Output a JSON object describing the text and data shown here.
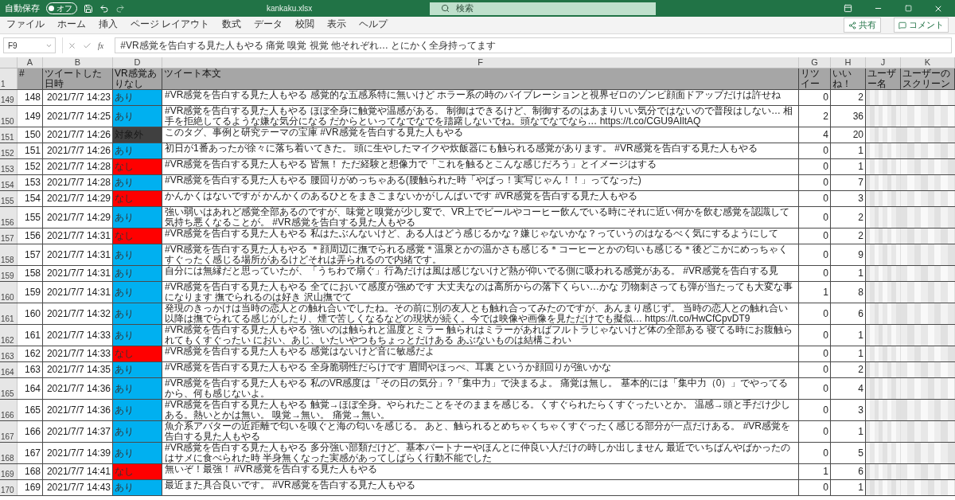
{
  "title_bar": {
    "autosave_label": "自動保存",
    "autosave_state": "オフ",
    "autosave_on": false,
    "filename": "kankaku.xlsx",
    "search_placeholder": "検索"
  },
  "ribbon_tabs": [
    {
      "label": "ファイル",
      "selected": false
    },
    {
      "label": "ホーム",
      "selected": false
    },
    {
      "label": "挿入",
      "selected": false
    },
    {
      "label": "ページ レイアウト",
      "selected": false
    },
    {
      "label": "数式",
      "selected": false
    },
    {
      "label": "データ",
      "selected": false
    },
    {
      "label": "校閲",
      "selected": false
    },
    {
      "label": "表示",
      "selected": false
    },
    {
      "label": "ヘルプ",
      "selected": false
    }
  ],
  "ribbon_actions": [
    "共有",
    "コメント"
  ],
  "formula_bar": {
    "name_box": "F9",
    "fx": "fx",
    "formula": "#VR感覚を告白する見た人もやる 痛覚 嗅覚 視覚 他それぞれ… とにかく全身持ってます"
  },
  "column_letters": [
    "A",
    "B",
    "D",
    "F",
    "G",
    "H",
    "J",
    "K"
  ],
  "header_row": {
    "row_number": "1",
    "cells": [
      "#",
      "ツイートした日時",
      "VR感覚ありなし",
      "ツイート本文",
      "リツイー",
      "いいね！",
      "ユーザー名",
      "ユーザーのスクリーン"
    ]
  },
  "rows": [
    {
      "row_number": "149",
      "index": "148",
      "date": "2021/7/7 14:23",
      "flag": "あり",
      "color": "#00b0f0",
      "text": "#VR感覚を告白する見た人もやる 感覚的な五感系特に無いけど ホラー系の時のバイブレーションと視界ゼロのゾンビ顔面ドアップだけは許せね",
      "retweets": "0",
      "likes": "2"
    },
    {
      "row_number": "150",
      "index": "149",
      "date": "2021/7/7 14:25",
      "flag": "あり",
      "color": "#00b0f0",
      "text": "#VR感覚を告白する見た人もやる ほぼ全身に触覚や温感がある。 制御はできるけど、制御するのはあまりいい気分ではないので普段はしない… 相手を拒絶してるような嫌な気分になる だからといってなでなでを躊躇しないでね。頭なでなでなら… https://t.co/CGU9AIltAQ",
      "retweets": "2",
      "likes": "36"
    },
    {
      "row_number": "151",
      "index": "150",
      "date": "2021/7/7 14:26",
      "flag": "対象外",
      "color": "#404040",
      "text": "このタグ、事例と研究テーマの宝庫 #VR感覚を告白する見た人もやる",
      "retweets": "4",
      "likes": "20"
    },
    {
      "row_number": "152",
      "index": "151",
      "date": "2021/7/7 14:26",
      "flag": "あり",
      "color": "#00b0f0",
      "text": "初日が1番あったが徐々に落ち着いてきた。 頭に生やしたマイクや炊飯器にも触られる感覚があります。 #VR感覚を告白する見た人もやる",
      "retweets": "0",
      "likes": "1"
    },
    {
      "row_number": "153",
      "index": "152",
      "date": "2021/7/7 14:28",
      "flag": "なし",
      "color": "#ff0000",
      "text": "#VR感覚を告白する見た人もやる 皆無！ ただ経験と想像力で「これを触るとこんな感じだろう」とイメージはする",
      "retweets": "0",
      "likes": "1"
    },
    {
      "row_number": "154",
      "index": "153",
      "date": "2021/7/7 14:28",
      "flag": "あり",
      "color": "#00b0f0",
      "text": "#VR感覚を告白する見た人もやる 腰回りがめっちゃある(腰触られた時「やばっ！実写じゃん！！」ってなった)",
      "retweets": "0",
      "likes": "7"
    },
    {
      "row_number": "155",
      "index": "154",
      "date": "2021/7/7 14:29",
      "flag": "なし",
      "color": "#ff0000",
      "text": "かんかくはないですが かんかくのあるひとをまきこまないかがしんぱいです #VR感覚を告白する見た人もやる",
      "retweets": "0",
      "likes": "3"
    },
    {
      "row_number": "156",
      "index": "155",
      "date": "2021/7/7 14:29",
      "flag": "あり",
      "color": "#00b0f0",
      "text": "強い弱いはあれど感覚全部あるのですが、味覚と嗅覚が少し変で、VR上でビールやコーヒー飲んでいる時にそれに近い何かを飲む感覚を認識して気持ち悪くなることが。 #VR感覚を告白する見た人もやる",
      "retweets": "0",
      "likes": "2"
    },
    {
      "row_number": "157",
      "index": "156",
      "date": "2021/7/7 14:31",
      "flag": "なし",
      "color": "#ff0000",
      "text": "#VR感覚を告白する見た人もやる 私はたぶんないけど、ある人はどう感じるかな？嫌じゃないかな？っていうのはなるべく気にするようにして",
      "retweets": "0",
      "likes": "2"
    },
    {
      "row_number": "158",
      "index": "157",
      "date": "2021/7/7 14:31",
      "flag": "あり",
      "color": "#00b0f0",
      "text": "#VR感覚を告白する見た人もやる ＊顔周辺に撫でられる感覚＊温泉とかの温かさも感じる＊コーヒーとかの匂いも感じる＊後どこかにめっちゃくすぐったく感じる場所があるけどそれは弄られるので内緒です。",
      "retweets": "0",
      "likes": "9"
    },
    {
      "row_number": "159",
      "index": "158",
      "date": "2021/7/7 14:31",
      "flag": "あり",
      "color": "#00b0f0",
      "text": "自分には無縁だと思っていたが、「うちわで扇ぐ」行為だけは風は感じないけど熱が仰いでる側に吸われる感覚がある。 #VR感覚を告白する見",
      "retweets": "0",
      "likes": "1"
    },
    {
      "row_number": "160",
      "index": "159",
      "date": "2021/7/7 14:31",
      "flag": "あり",
      "color": "#00b0f0",
      "text": "#VR感覚を告白する見た人もやる 全てにおいて感度が強めです 大丈夫なのは高所からの落下くらい…かな 刃物刺さっても弾が当たっても大変な事になります 撫でられるのは好き 沢山撫でて",
      "retweets": "1",
      "likes": "8"
    },
    {
      "row_number": "161",
      "index": "160",
      "date": "2021/7/7 14:32",
      "flag": "あり",
      "color": "#00b0f0",
      "text": "発現のきっかけは当時の恋人との触れ合いでしたね。その前に別の友人とも触れ合ってみたのですが、あんまり感じず。 当時の恋人との触れ合い以降は撫でられてる感じがしたり、煙で苦しくなるなどの現状が続く。今では映像や画像を見ただけでも擬似… https://t.co/HwCfCpvDT9",
      "retweets": "0",
      "likes": "6"
    },
    {
      "row_number": "162",
      "index": "161",
      "date": "2021/7/7 14:33",
      "flag": "あり",
      "color": "#00b0f0",
      "text": "#VR感覚を告白する見た人もやる 強いのは触られと温度とミラー 触られはミラーがあればフルトラじゃないけど体の全部ある 寝てる時にお腹触られてもくすぐったい におい、あじ、いたいやつもちょっとだけある あぶないものは結構こわい",
      "retweets": "0",
      "likes": "1"
    },
    {
      "row_number": "163",
      "index": "162",
      "date": "2021/7/7 14:33",
      "flag": "なし",
      "color": "#ff0000",
      "text": "#VR感覚を告白する見た人もやる 感覚はないけど音に敏感だよ",
      "retweets": "0",
      "likes": "1"
    },
    {
      "row_number": "164",
      "index": "163",
      "date": "2021/7/7 14:35",
      "flag": "あり",
      "color": "#00b0f0",
      "text": "#VR感覚を告白する見た人もやる 全身脆弱性だらけです 眉間やほっぺ、耳裏 というか顔回りが強いかな",
      "retweets": "0",
      "likes": "2"
    },
    {
      "row_number": "165",
      "index": "164",
      "date": "2021/7/7 14:36",
      "flag": "あり",
      "color": "#00b0f0",
      "text": "#VR感覚を告白する見た人もやる 私のVR感度は「その日の気分」?「集中力」で決まるよ。 痛覚は無し。 基本的には「集中力（0）」でやってるから、何も感じないよ。",
      "retweets": "0",
      "likes": "4"
    },
    {
      "row_number": "166",
      "index": "165",
      "date": "2021/7/7 14:36",
      "flag": "あり",
      "color": "#00b0f0",
      "text": "#VR感覚を告白する見た人もやる 触覚→ほぼ全身。やられたことをそのままを感じる。くすぐられたらくすぐったいとか。 温感→頭と手だけ少しある。熱いとかは無い。 嗅覚→無い。 痛覚→無い。",
      "retweets": "0",
      "likes": "3"
    },
    {
      "row_number": "167",
      "index": "166",
      "date": "2021/7/7 14:37",
      "flag": "あり",
      "color": "#00b0f0",
      "text": "魚介系アバターの近距離で匂いを嗅ぐと海の匂いを感じる。 あと、触られるとめちゃくちゃくすぐったく感じる部分が一点だけある。 #VR感覚を告白する見た人もやる",
      "retweets": "0",
      "likes": "1"
    },
    {
      "row_number": "168",
      "index": "167",
      "date": "2021/7/7 14:39",
      "flag": "あり",
      "color": "#00b0f0",
      "text": "#VR感覚を告白する見た人もやる 多分強い部類だけど、基本パートナーやほんとに仲良い人だけの時しか出しません 最近でいちばんやばかったのはサメに食べられた時 半身無くなった実感があってしばらく行動不能でした",
      "retweets": "0",
      "likes": "5"
    },
    {
      "row_number": "169",
      "index": "168",
      "date": "2021/7/7 14:41",
      "flag": "なし",
      "color": "#ff0000",
      "text": "無いぞ！最強！ #VR感覚を告白する見た人もやる",
      "retweets": "1",
      "likes": "6"
    },
    {
      "row_number": "170",
      "index": "169",
      "date": "2021/7/7 14:43",
      "flag": "あり",
      "color": "#00b0f0",
      "text": "最近また具合良いです。 #VR感覚を告白する見た人もやる",
      "retweets": "0",
      "likes": "1"
    }
  ]
}
